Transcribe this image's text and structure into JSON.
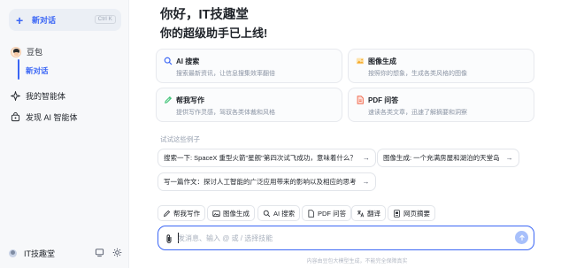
{
  "sidebar": {
    "new_chat": {
      "label": "新对话",
      "shortcut": "Ctrl K"
    },
    "bot": {
      "name": "豆包",
      "sub_item": "新对话"
    },
    "links": [
      {
        "label": "我的智能体",
        "icon": "sparkle-icon"
      },
      {
        "label": "发现 AI 智能体",
        "icon": "bot-store-icon"
      }
    ],
    "user": {
      "name": "IT技趣堂"
    }
  },
  "main": {
    "greeting_line1": "你好，IT技趣堂",
    "greeting_line2": "你的超级助手已上线!",
    "cards": [
      {
        "title": "AI 搜索",
        "desc": "搜索最新资讯，让信息搜集效率翻倍",
        "icon": "search-icon",
        "color": "#3b66f5"
      },
      {
        "title": "图像生成",
        "desc": "按照你的想象，生成各类风格的图像",
        "icon": "image-icon",
        "color": "#f5a623"
      },
      {
        "title": "帮我写作",
        "desc": "提供写作灵感，驾驭各类体裁和风格",
        "icon": "pen-icon",
        "color": "#2ebd6b"
      },
      {
        "title": "PDF 问答",
        "desc": "速读各类文章，迅速了解摘要和洞察",
        "icon": "pdf-icon",
        "color": "#f05a3c"
      }
    ],
    "try_label": "试试这些例子",
    "examples": [
      "搜索一下: SpaceX 重型火箭\"星舰\"第四次试飞成功，意味着什么？",
      "图像生成: 一个充满房屋和湖泊的天堂岛",
      "写一篇作文：探讨人工智能的广泛应用带来的影响以及相应的思考"
    ],
    "tools": [
      {
        "label": "帮我写作",
        "icon": "pen-icon"
      },
      {
        "label": "图像生成",
        "icon": "image-icon"
      },
      {
        "label": "AI 搜索",
        "icon": "search-icon"
      },
      {
        "label": "PDF 问答",
        "icon": "pdf-icon"
      },
      {
        "label": "翻译",
        "icon": "translate-icon"
      },
      {
        "label": "网页摘要",
        "icon": "web-summary-icon"
      }
    ],
    "input": {
      "placeholder": "发消息、输入 @ 或 / 选择技能",
      "value": ""
    },
    "disclaimer": "内容由豆包大模型生成，不能完全保障真实"
  },
  "colors": {
    "accent": "#3b66f5",
    "sidebar_bg": "#f7f8fa"
  }
}
